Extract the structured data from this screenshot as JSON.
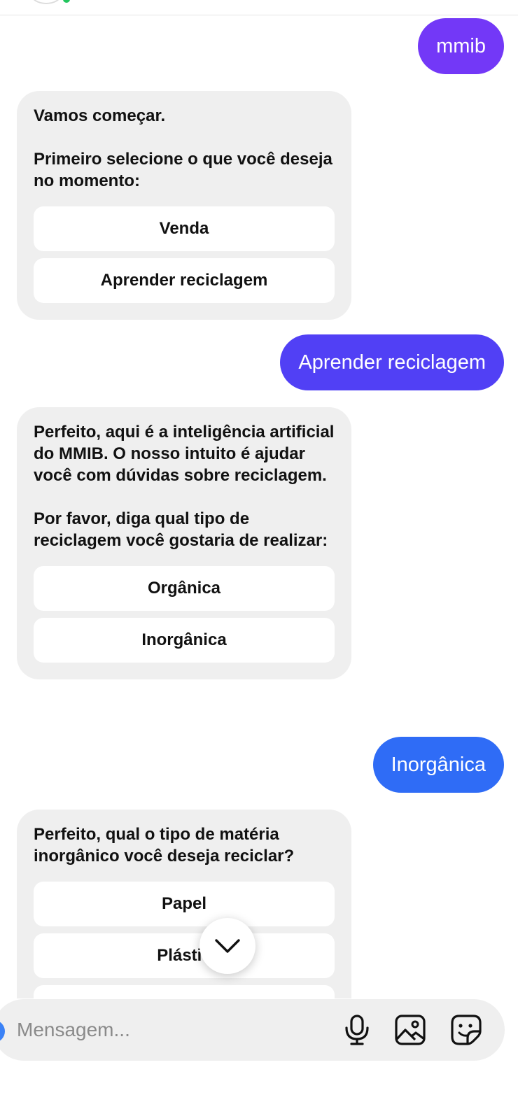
{
  "conversation": {
    "messages": [
      {
        "id": "m1",
        "direction": "outgoing",
        "text": "mmib",
        "bubble_color": "#7338f7"
      },
      {
        "id": "m2",
        "direction": "incoming",
        "text": "Vamos começar.\n\nPrimeiro selecione o que você deseja no momento:",
        "options": [
          "Venda",
          "Aprender reciclagem"
        ]
      },
      {
        "id": "m3",
        "direction": "outgoing",
        "text": "Aprender reciclagem",
        "bubble_color": "#5140f5"
      },
      {
        "id": "m4",
        "direction": "incoming",
        "text": "Perfeito, aqui é a inteligência artificial do MMIB. O nosso intuito é ajudar você com dúvidas sobre reciclagem.\n\nPor favor, diga qual tipo de reciclagem você gostaria de realizar:",
        "options": [
          "Orgânica",
          "Inorgânica"
        ]
      },
      {
        "id": "m5",
        "direction": "outgoing",
        "text": "Inorgânica",
        "bubble_color": "#2f6cf6"
      },
      {
        "id": "m6",
        "direction": "incoming",
        "text": "Perfeito, qual o tipo de matéria inorgânico você deseja reciclar?",
        "options": [
          "Papel",
          "Plástic",
          ""
        ]
      }
    ]
  },
  "composer": {
    "placeholder": "Mensagem...",
    "value": ""
  },
  "icons": {
    "scroll": "chevron-down-icon",
    "mic": "microphone-icon",
    "gallery": "image-icon",
    "sticker": "sticker-icon"
  },
  "colors": {
    "incoming_bubble": "#efefef",
    "option_button": "#ffffff"
  }
}
